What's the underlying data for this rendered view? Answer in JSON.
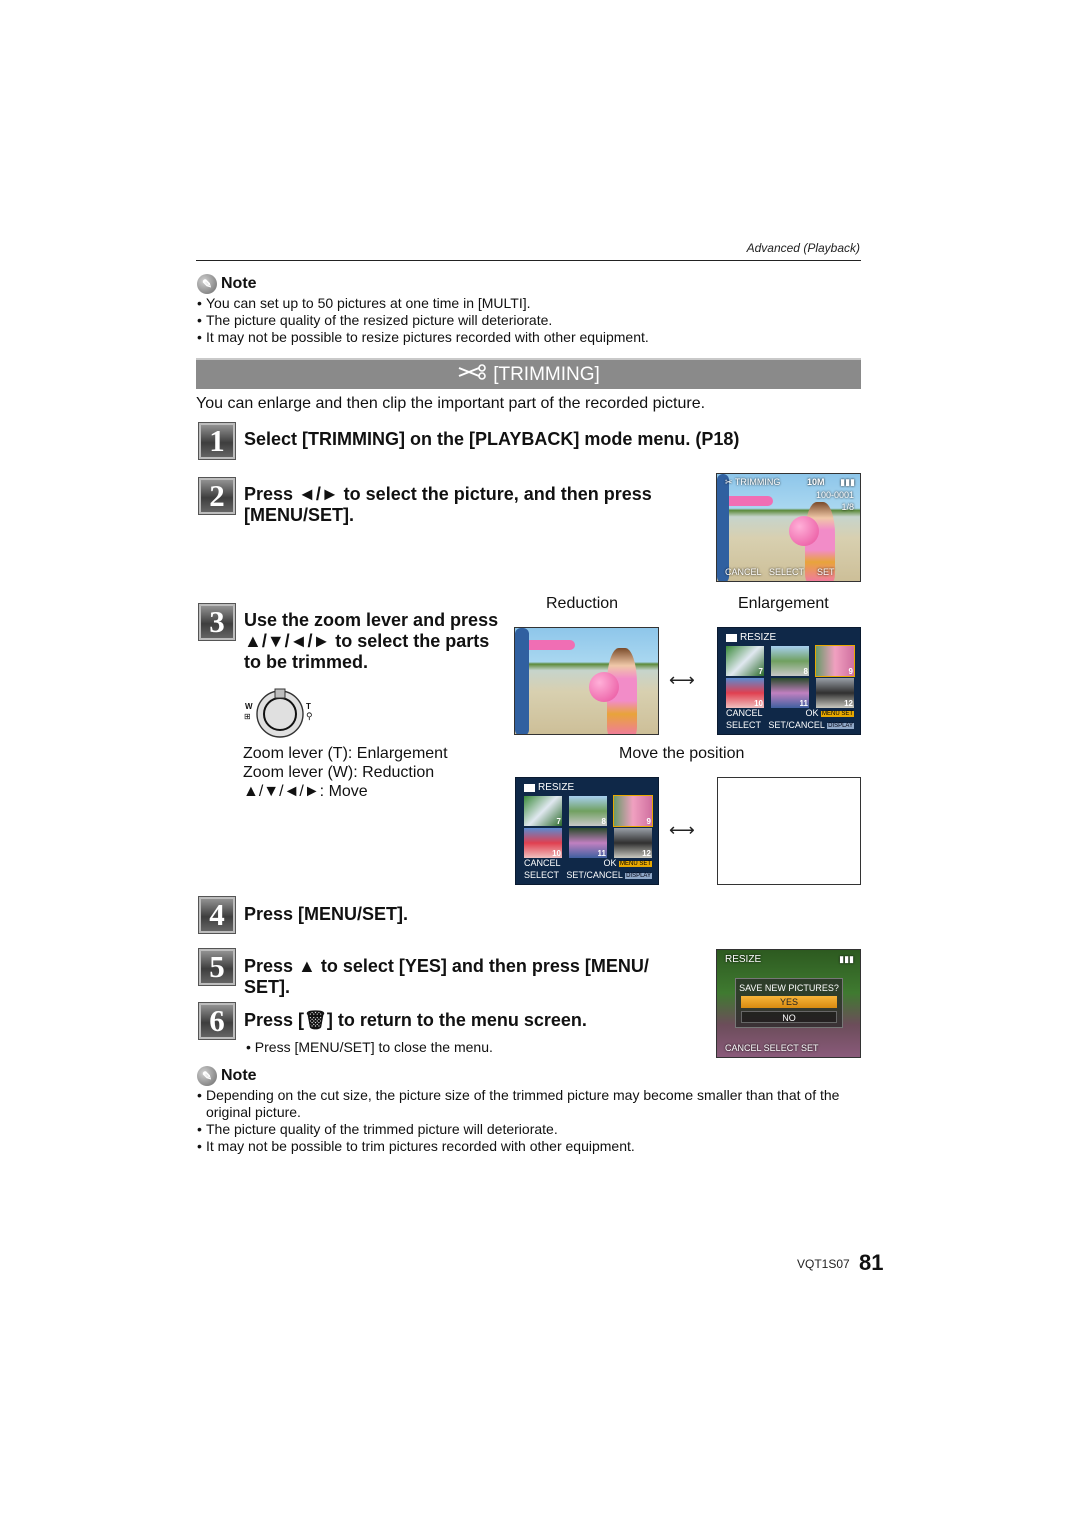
{
  "header": {
    "section": "Advanced (Playback)"
  },
  "note_top": {
    "title": "Note",
    "icon": "pencil-icon",
    "items": [
      "You can set up to 50 pictures at one time in [MULTI].",
      "The picture quality of the resized picture will deteriorate.",
      "It may not be possible to resize pictures recorded with other equipment."
    ]
  },
  "banner": {
    "icon": "scissors-icon",
    "title": "[TRIMMING]"
  },
  "intro": "You can enlarge and then clip the important part of the recorded picture.",
  "steps": [
    {
      "num": "1",
      "text": "Select [TRIMMING] on the [PLAYBACK] mode menu. (P18)"
    },
    {
      "num": "2",
      "text": "Press ◄/► to select the picture, and then press [MENU/SET]."
    },
    {
      "num": "3",
      "text": "Use the zoom lever and press ▲/▼/◄/► to select the parts to be trimmed."
    },
    {
      "num": "4",
      "text": "Press [MENU/SET]."
    },
    {
      "num": "5",
      "text": "Press ▲ to select [YES] and then press [MENU/ SET]."
    },
    {
      "num": "6",
      "text": "Press [🗑] to return to the menu screen.",
      "sub": "Press [MENU/SET] to close the menu."
    }
  ],
  "step2_screen": {
    "mode": "✂ TRIMMING",
    "size": "10M",
    "file": "100-0001",
    "count": "1/8",
    "cancel": "CANCEL",
    "select": "SELECT",
    "set": "SET"
  },
  "step3": {
    "lever_w": "W",
    "lever_t": "T",
    "captions": [
      "Zoom lever (T): Enlargement",
      "Zoom lever (W): Reduction",
      "▲/▼/◄/►: Move"
    ],
    "reduction_label": "Reduction",
    "enlargement_label": "Enlargement",
    "move_label": "Move the position",
    "arrow": "⟷"
  },
  "resize_screen": {
    "title": "RESIZE",
    "thumbs": [
      "7",
      "8",
      "9",
      "10",
      "11",
      "12"
    ],
    "cancel": "CANCEL",
    "ok": "OK",
    "menu_badge": "MENU SET",
    "select": "SELECT",
    "set_cancel": "SET/CANCEL",
    "display_badge": "DISPLAY"
  },
  "save_screen": {
    "title": "RESIZE",
    "question": "SAVE NEW PICTURES?",
    "yes": "YES",
    "no": "NO",
    "footer": "CANCEL  SELECT  SET"
  },
  "note_bottom": {
    "title": "Note",
    "icon": "pencil-icon",
    "items": [
      "Depending on the cut size, the picture size of the trimmed picture may become smaller than that of the original picture.",
      "The picture quality of the trimmed picture will deteriorate.",
      "It may not be possible to trim pictures recorded with other equipment."
    ]
  },
  "footer": {
    "code": "VQT1S07",
    "page": "81"
  },
  "colors": {
    "banner_bg": "#8a8a8a",
    "screen_bg": "#0f2848",
    "highlight": "#e8a800"
  }
}
